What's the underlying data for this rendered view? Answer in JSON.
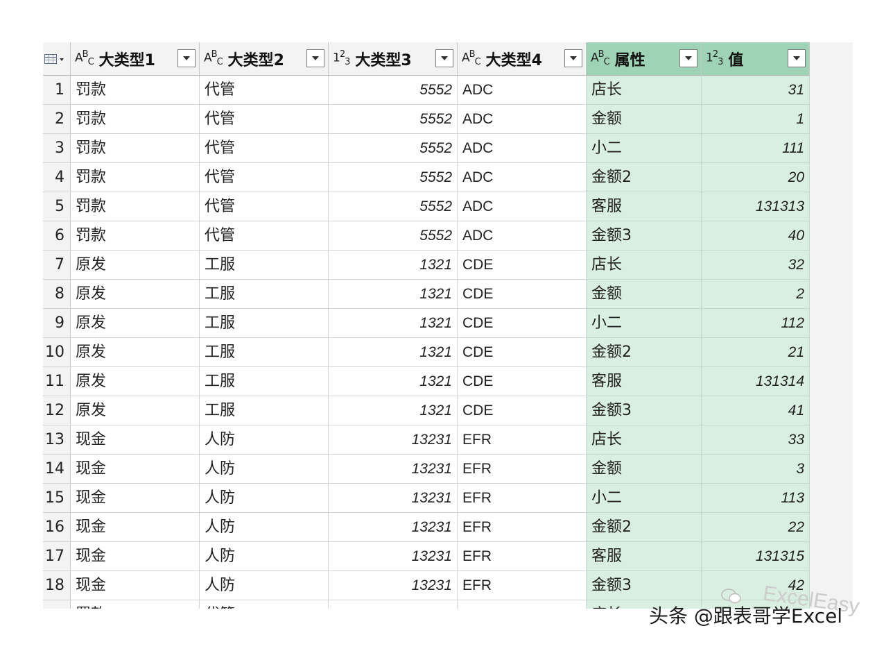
{
  "columns": [
    {
      "type_icon": "ABC",
      "label": "大类型1",
      "kind": "text"
    },
    {
      "type_icon": "ABC",
      "label": "大类型2",
      "kind": "text"
    },
    {
      "type_icon": "123",
      "label": "大类型3",
      "kind": "num"
    },
    {
      "type_icon": "ABC",
      "label": "大类型4",
      "kind": "text"
    },
    {
      "type_icon": "ABC",
      "label": "属性",
      "kind": "text",
      "selected": true
    },
    {
      "type_icon": "123",
      "label": "值",
      "kind": "num",
      "selected": true
    }
  ],
  "rows": [
    {
      "n": "1",
      "c": [
        "罚款",
        "代管",
        "5552",
        "ADC",
        "店长",
        "31"
      ]
    },
    {
      "n": "2",
      "c": [
        "罚款",
        "代管",
        "5552",
        "ADC",
        "金额",
        "1"
      ]
    },
    {
      "n": "3",
      "c": [
        "罚款",
        "代管",
        "5552",
        "ADC",
        "小二",
        "111"
      ]
    },
    {
      "n": "4",
      "c": [
        "罚款",
        "代管",
        "5552",
        "ADC",
        "金额2",
        "20"
      ]
    },
    {
      "n": "5",
      "c": [
        "罚款",
        "代管",
        "5552",
        "ADC",
        "客服",
        "131313"
      ]
    },
    {
      "n": "6",
      "c": [
        "罚款",
        "代管",
        "5552",
        "ADC",
        "金额3",
        "40"
      ]
    },
    {
      "n": "7",
      "c": [
        "原发",
        "工服",
        "1321",
        "CDE",
        "店长",
        "32"
      ]
    },
    {
      "n": "8",
      "c": [
        "原发",
        "工服",
        "1321",
        "CDE",
        "金额",
        "2"
      ]
    },
    {
      "n": "9",
      "c": [
        "原发",
        "工服",
        "1321",
        "CDE",
        "小二",
        "112"
      ]
    },
    {
      "n": "10",
      "c": [
        "原发",
        "工服",
        "1321",
        "CDE",
        "金额2",
        "21"
      ]
    },
    {
      "n": "11",
      "c": [
        "原发",
        "工服",
        "1321",
        "CDE",
        "客服",
        "131314"
      ]
    },
    {
      "n": "12",
      "c": [
        "原发",
        "工服",
        "1321",
        "CDE",
        "金额3",
        "41"
      ]
    },
    {
      "n": "13",
      "c": [
        "现金",
        "人防",
        "13231",
        "EFR",
        "店长",
        "33"
      ]
    },
    {
      "n": "14",
      "c": [
        "现金",
        "人防",
        "13231",
        "EFR",
        "金额",
        "3"
      ]
    },
    {
      "n": "15",
      "c": [
        "现金",
        "人防",
        "13231",
        "EFR",
        "小二",
        "113"
      ]
    },
    {
      "n": "16",
      "c": [
        "现金",
        "人防",
        "13231",
        "EFR",
        "金额2",
        "22"
      ]
    },
    {
      "n": "17",
      "c": [
        "现金",
        "人防",
        "13231",
        "EFR",
        "客服",
        "131315"
      ]
    },
    {
      "n": "18",
      "c": [
        "现金",
        "人防",
        "13231",
        "EFR",
        "金额3",
        "42"
      ]
    },
    {
      "n": "",
      "c": [
        "罚款",
        "代管",
        "",
        "",
        "店长",
        ""
      ]
    }
  ],
  "watermark": {
    "text": "头条 @跟表哥学Excel",
    "ghost_text": "ExcelEasy"
  },
  "colors": {
    "selected_header": "#9ed4b5",
    "selected_cell": "#d8efe2"
  }
}
